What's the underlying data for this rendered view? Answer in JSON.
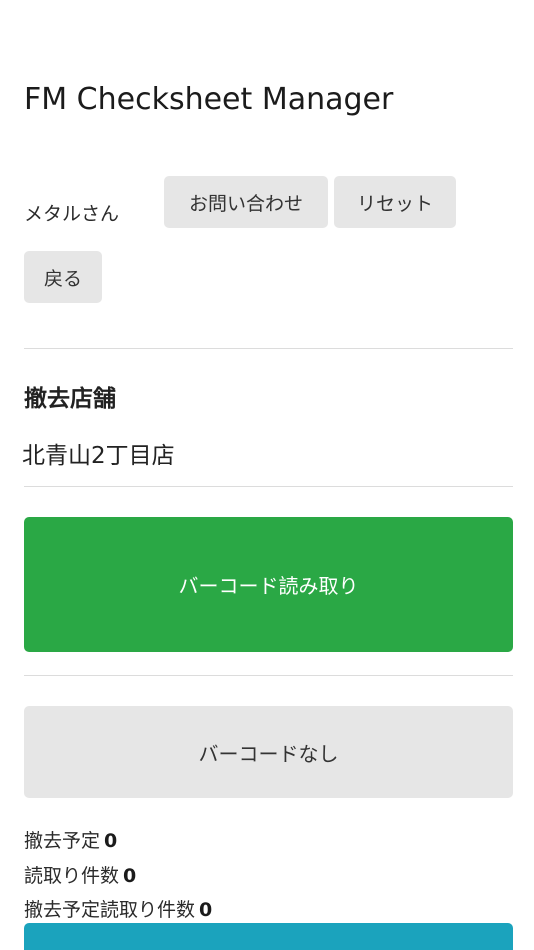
{
  "header": {
    "title": "FM Checksheet Manager"
  },
  "user": {
    "name": "メタルさん"
  },
  "actions": {
    "contact_label": "お問い合わせ",
    "reset_label": "リセット",
    "back_label": "戻る"
  },
  "store": {
    "heading": "撤去店舗",
    "name": "北青山2丁目店"
  },
  "scan": {
    "barcode_read_label": "バーコード読み取り",
    "no_barcode_label": "バーコードなし"
  },
  "stats": {
    "planned_label": "撤去予定",
    "planned_value": "0",
    "read_label": "読取り件数",
    "read_value": "0",
    "planned_read_label": "撤去予定読取り件数",
    "planned_read_value": "0"
  },
  "colors": {
    "scan_button": "#2aa845",
    "gray_button": "#e6e6e6",
    "bottom_bar": "#1ba3bd"
  }
}
